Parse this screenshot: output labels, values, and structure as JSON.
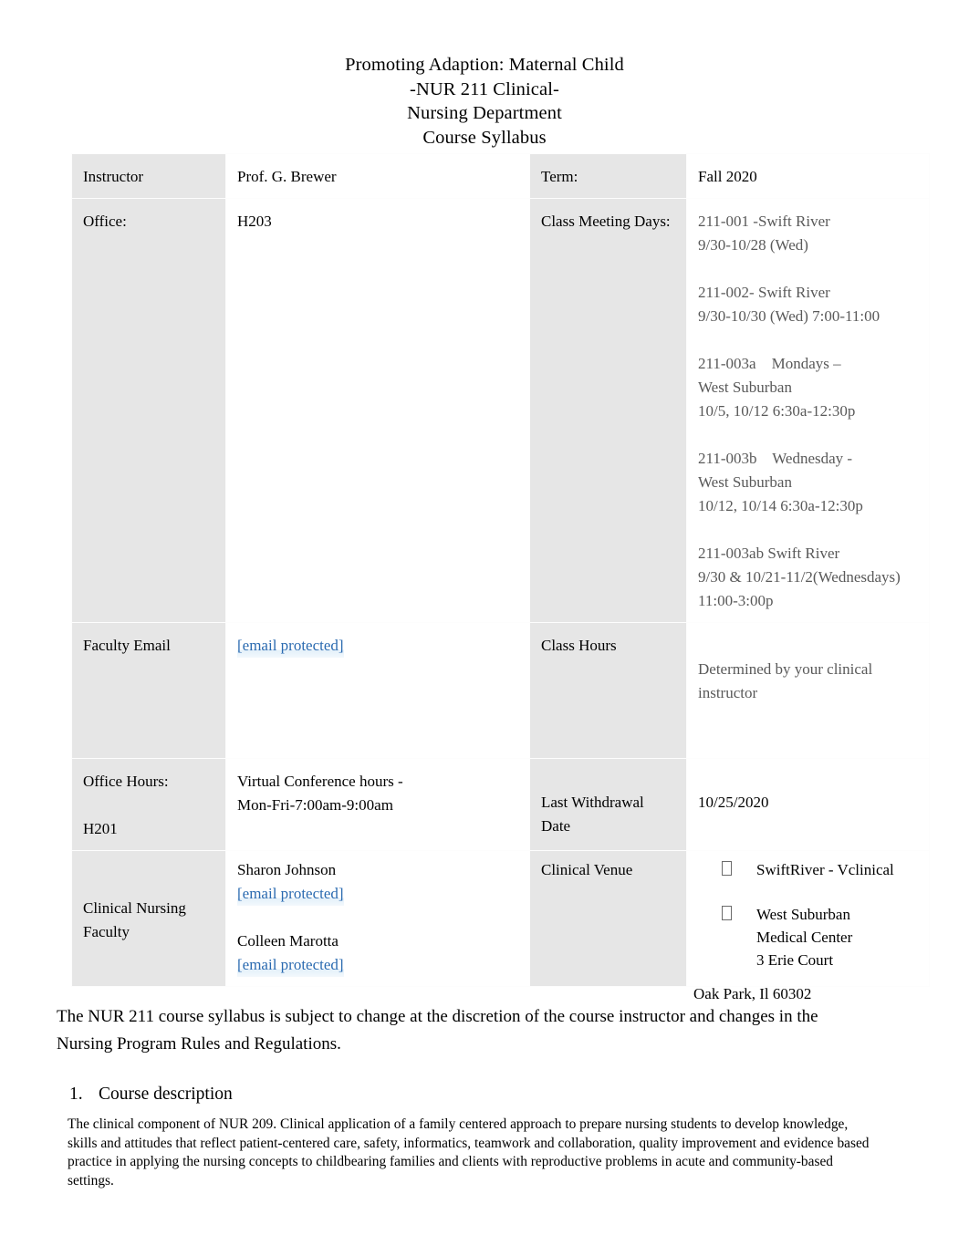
{
  "document": {
    "title_lines": [
      "Promoting Adaption: Maternal Child",
      "-NUR 211 Clinical-",
      "Nursing Department",
      "Course Syllabus"
    ]
  },
  "info_table": {
    "rows": [
      {
        "label_left": "Instructor",
        "value_left": "Prof. G. Brewer",
        "label_right": "Term:",
        "value_right": "Fall 2020"
      },
      {
        "label_left": "Office:",
        "value_left": "H203",
        "label_right": "Class Meeting Days:",
        "value_right_blocks": [
          "211-001 -Swift River\n9/30-10/28 (Wed)",
          "211-002- Swift River\n9/30-10/30 (Wed) 7:00-11:00",
          "211-003a    Mondays –\nWest Suburban\n10/5, 10/12 6:30a-12:30p",
          "211-003b    Wednesday -\nWest Suburban\n10/12, 10/14 6:30a-12:30p",
          "211-003ab Swift River\n9/30 & 10/21-11/2(Wednesdays)\n11:00-3:00p"
        ]
      },
      {
        "label_left": "Faculty Email",
        "value_left_email": "[email protected]",
        "label_right": "Class Hours",
        "value_right": "Determined by your clinical instructor"
      },
      {
        "label_left_line1": "Office Hours:",
        "label_left_line2": "H201",
        "value_left": "Virtual Conference hours -\nMon-Fri-7:00am-9:00am",
        "label_right": "Last Withdrawal Date",
        "value_right": "10/25/2020"
      },
      {
        "label_left": "Clinical Nursing Faculty",
        "faculty": [
          {
            "name": "Sharon Johnson",
            "email": "[email protected]"
          },
          {
            "name": "Colleen Marotta",
            "email": "[email protected]"
          }
        ],
        "label_right": "Clinical Venue",
        "venues": [
          "SwiftRiver - Vclinical",
          "West Suburban\nMedical Center\n3 Erie Court"
        ],
        "venue_overflow_line": "Oak Park, Il 60302"
      }
    ]
  },
  "disclaimer": "The NUR 211 course syllabus is subject to change at the discretion of the course instructor and changes in the Nursing Program Rules and Regulations.",
  "sections": [
    {
      "number": "1.",
      "heading": "Course description",
      "body": "The clinical component of NUR 209. Clinical application of a family centered approach to prepare nursing students to develop knowledge, skills and attitudes that reflect patient-centered care, safety, informatics, teamwork and collaboration, quality improvement and evidence based practice in applying the nursing concepts to childbearing families and clients with reproductive problems in acute and community-based settings."
    }
  ],
  "colors": {
    "label_cell_bg": "#e6e6e6",
    "link": "#2a6ab0",
    "muted_text": "#595959"
  }
}
